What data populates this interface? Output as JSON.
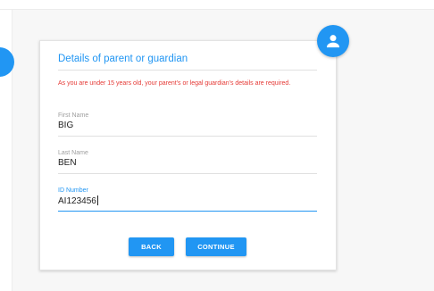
{
  "form": {
    "title": "Details of parent or guardian",
    "notice": "As you are under 15 years old, your parent's or legal guardian's details are required.",
    "fields": [
      {
        "label": "First Name",
        "value": "BIG"
      },
      {
        "label": "Last Name",
        "value": "BEN"
      },
      {
        "label": "ID Number",
        "value": "AI123456"
      }
    ],
    "buttons": {
      "back": "BACK",
      "continue": "CONTINUE"
    }
  },
  "colors": {
    "accent": "#2196f3",
    "error": "#e53935"
  },
  "icons": {
    "avatar": "person-icon"
  }
}
